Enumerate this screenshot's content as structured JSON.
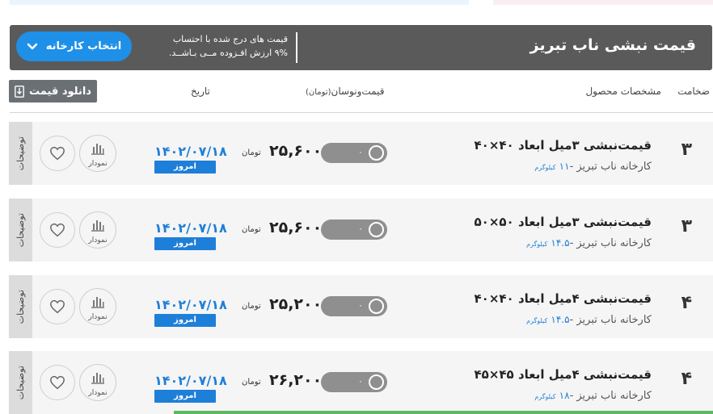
{
  "header": {
    "title": "قیمت نبشی ناب تبریز",
    "note_line1": "قیمت های درج شده با احتساب",
    "note_line2": "۹% ارزش افـزوده مــی بـاشــد.",
    "select_factory_label": "انتخاب کارخانه"
  },
  "toolbar": {
    "download_label": "دانلود قیمت"
  },
  "columns": {
    "thickness": "ضخامت",
    "spec": "مشخصات محصول",
    "price": "قیمت‌ونوسان",
    "price_unit": "(تومان)",
    "date": "تاریخ"
  },
  "rows": [
    {
      "thickness": "۳",
      "title": "قیمت‌نبشی ۳میل ابعاد ۴۰×۴۰",
      "factory": "کارخانه ناب تبریز -",
      "weight": "۱۱",
      "weight_unit": "کیلوگرم",
      "change": "۰",
      "price": "۲۵,۶۰۰",
      "currency": "تومان",
      "date": "۱۴۰۲/۰۷/۱۸",
      "badge": "امروز",
      "chart_label": "نمودار",
      "desc_label": "توضیحات"
    },
    {
      "thickness": "۳",
      "title": "قیمت‌نبشی ۳میل ابعاد ۵۰×۵۰",
      "factory": "کارخانه ناب تبریز -",
      "weight": "۱۴.۵",
      "weight_unit": "کیلوگرم",
      "change": "۰",
      "price": "۲۵,۶۰۰",
      "currency": "تومان",
      "date": "۱۴۰۲/۰۷/۱۸",
      "badge": "امروز",
      "chart_label": "نمودار",
      "desc_label": "توضیحات"
    },
    {
      "thickness": "۴",
      "title": "قیمت‌نبشی ۴میل ابعاد ۴۰×۴۰",
      "factory": "کارخانه ناب تبریز -",
      "weight": "۱۴.۵",
      "weight_unit": "کیلوگرم",
      "change": "۰",
      "price": "۲۵,۲۰۰",
      "currency": "تومان",
      "date": "۱۴۰۲/۰۷/۱۸",
      "badge": "امروز",
      "chart_label": "نمودار",
      "desc_label": "توضیحات"
    },
    {
      "thickness": "۴",
      "title": "قیمت‌نبشی ۴میل ابعاد ۴۵×۴۵",
      "factory": "کارخانه ناب تبریز -",
      "weight": "۱۸",
      "weight_unit": "کیلوگرم",
      "change": "۰",
      "price": "۲۶,۲۰۰",
      "currency": "تومان",
      "date": "۱۴۰۲/۰۷/۱۸",
      "badge": "امروز",
      "chart_label": "نمودار",
      "desc_label": "توضیحات"
    }
  ],
  "colors": {
    "accent": "#1e90e8",
    "header_bg": "#5a5a5a",
    "row_bg": "#f5f5f5"
  }
}
